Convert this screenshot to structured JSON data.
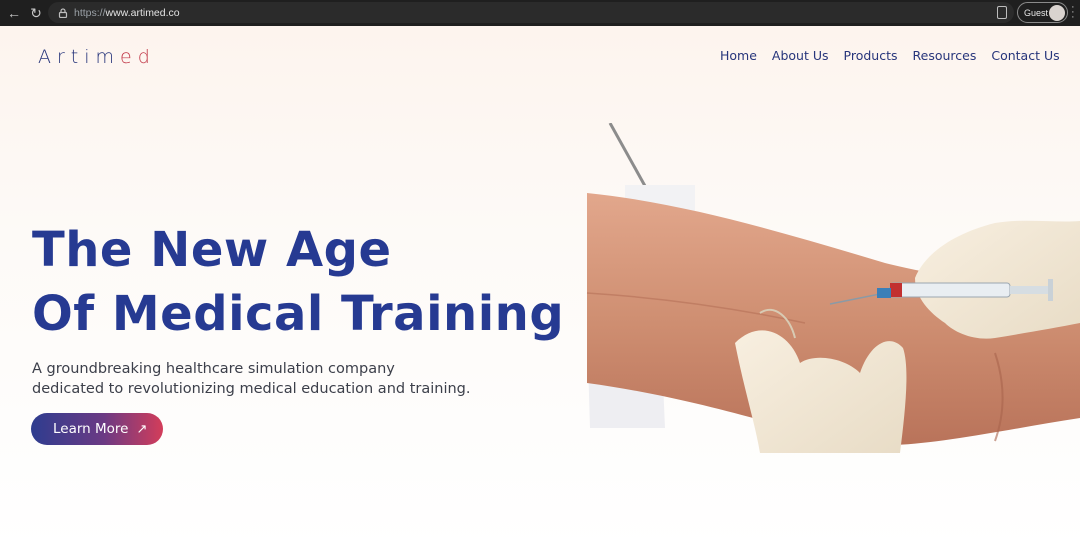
{
  "browser": {
    "url_scheme": "https://",
    "url_host": "www.artimed.co",
    "profile_label": "Guest"
  },
  "site": {
    "logo_left": "Artim",
    "logo_right": "ed"
  },
  "nav": {
    "items": [
      {
        "label": "Home"
      },
      {
        "label": "About Us"
      },
      {
        "label": "Products"
      },
      {
        "label": "Resources"
      },
      {
        "label": "Contact Us"
      }
    ]
  },
  "hero": {
    "title_line1": "The New Age",
    "title_line2": "Of Medical Training",
    "subtitle_line1": "A groundbreaking healthcare simulation company",
    "subtitle_line2": "dedicated to revolutionizing medical education and training.",
    "cta_label": "Learn More",
    "cta_icon": "arrow-up-right-icon"
  },
  "colors": {
    "brand_blue": "#263a92",
    "brand_red": "#c23a4a"
  }
}
